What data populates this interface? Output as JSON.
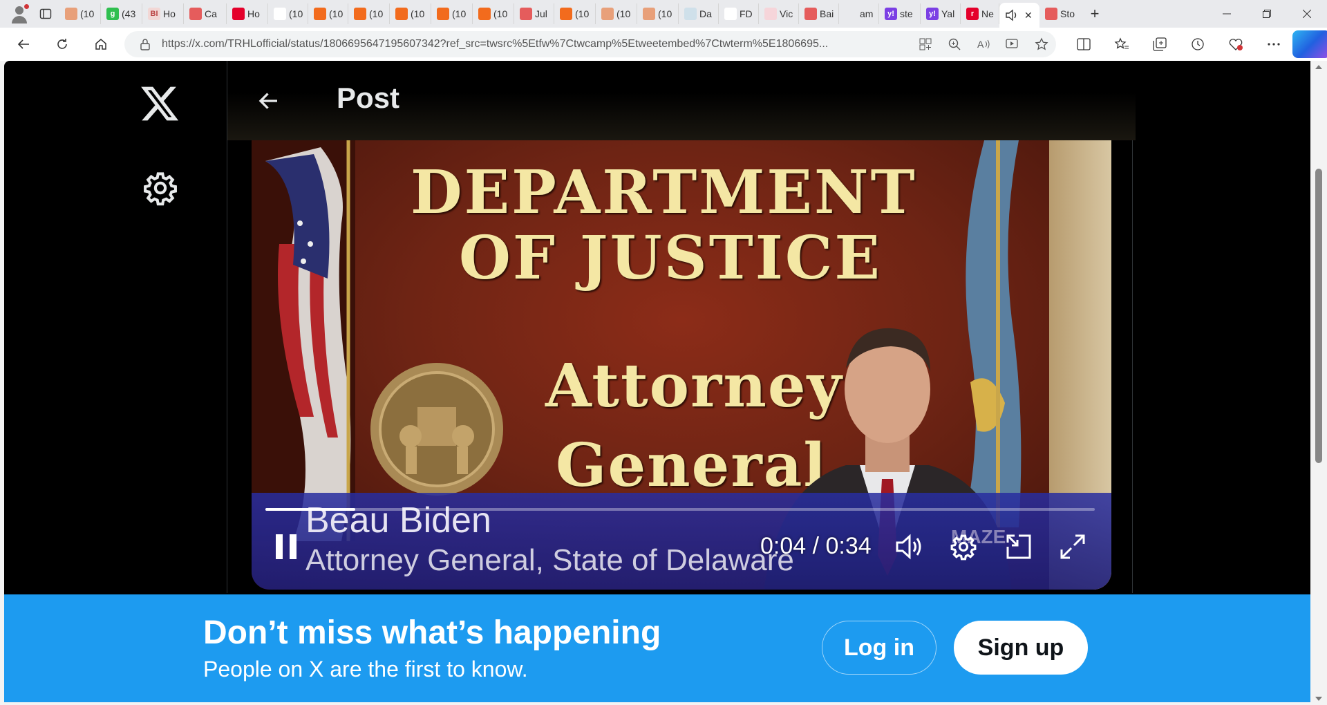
{
  "browser": {
    "tabs": [
      {
        "label": "(10",
        "fav_color": "#e8a07a",
        "icon": "bookmark-icon"
      },
      {
        "label": "(43",
        "fav_color": "#2fbf4f",
        "icon": "grammarly-icon",
        "fav_text": "g"
      },
      {
        "label": "Ho",
        "fav_color": "#f2d7d5",
        "icon": "bi-icon",
        "fav_text": "BI"
      },
      {
        "label": "Ca",
        "fav_color": "#e55c5c",
        "icon": "youtube-icon"
      },
      {
        "label": "Ho",
        "fav_color": "#e4002b",
        "icon": "news-icon"
      },
      {
        "label": "(10",
        "fav_color": "#ffffff",
        "icon": "page-icon"
      },
      {
        "label": "(10",
        "fav_color": "#f26b1d",
        "icon": "bookmark-icon"
      },
      {
        "label": "(10",
        "fav_color": "#f26b1d",
        "icon": "bookmark-icon"
      },
      {
        "label": "(10",
        "fav_color": "#f26b1d",
        "icon": "bookmark-icon"
      },
      {
        "label": "(10",
        "fav_color": "#f26b1d",
        "icon": "bookmark-icon"
      },
      {
        "label": "(10",
        "fav_color": "#f26b1d",
        "icon": "bookmark-icon"
      },
      {
        "label": "Jul",
        "fav_color": "#e55c5c",
        "icon": "youtube-icon"
      },
      {
        "label": "(10",
        "fav_color": "#f26b1d",
        "icon": "bookmark-icon"
      },
      {
        "label": "(10",
        "fav_color": "#e8a07a",
        "icon": "bookmark-icon"
      },
      {
        "label": "(10",
        "fav_color": "#e8a07a",
        "icon": "bookmark-icon"
      },
      {
        "label": "Da",
        "fav_color": "#cfe0ea",
        "icon": "globe-icon"
      },
      {
        "label": "FD",
        "fav_color": "#ffffff",
        "icon": "page-icon"
      },
      {
        "label": "Vic",
        "fav_color": "#f6d5da",
        "icon": "star-icon"
      },
      {
        "label": "Bai",
        "fav_color": "#e55c5c",
        "icon": "youtube-icon"
      },
      {
        "label": "am",
        "fav_color": "#e9eaed",
        "icon": "search-icon"
      },
      {
        "label": "ste",
        "fav_color": "#7b3fe4",
        "icon": "yahoo-icon",
        "fav_text": "y!"
      },
      {
        "label": "Yal",
        "fav_color": "#7b3fe4",
        "icon": "yahoo-icon",
        "fav_text": "y!"
      },
      {
        "label": "Ne",
        "fav_color": "#e4002b",
        "icon": "news-icon",
        "fav_text": "r"
      }
    ],
    "active_tab": {
      "label": "",
      "icon": "speaker-icon"
    },
    "after_tab": {
      "label": "Sto",
      "fav_color": "#e55c5c",
      "icon": "youtube-icon"
    },
    "url": "https://x.com/TRHLofficial/status/1806695647195607342?ref_src=twsrc%5Etfw%7Ctwcamp%5Etweetembed%7Ctwterm%5E1806695..."
  },
  "page": {
    "header_title": "Post"
  },
  "video": {
    "sign_line1": "DEPARTMENT",
    "sign_line2": "OF  JUSTICE",
    "sign_line3": "Attorney",
    "sign_line4": "General",
    "lower_third_name": "Beau Biden",
    "lower_third_title": "Attorney General, State of Delaware",
    "watermark": "MAZE",
    "current_time": "0:04",
    "duration": "0:34",
    "time_display": "0:04 / 0:34",
    "progress_fraction": 0.108
  },
  "banner": {
    "title": "Don’t miss what’s happening",
    "subtitle": "People on X are the first to know.",
    "login_label": "Log in",
    "signup_label": "Sign up"
  },
  "colors": {
    "x_blue": "#1d9bf0",
    "background": "#000000",
    "text_light": "#e7e9ea"
  }
}
